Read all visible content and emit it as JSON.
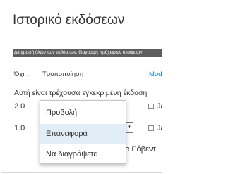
{
  "panel": {
    "title": "Ιστορικό εκδόσεων",
    "command_bar_text": "Διαγραφή όλων των εκδόσεων, διαγραφή πρόχειρων στοιχείων"
  },
  "columns": {
    "no": "Όχι ↓",
    "modified": "Τροποποίηση",
    "modified_by": "Mod"
  },
  "current_note": "Αυτή είναι τρέχουσα εγκεκριμένη έκδοση",
  "versions": [
    {
      "number": "2.0",
      "side_text": "Ja"
    },
    {
      "number": "1.0",
      "side_text": "Ja"
    }
  ],
  "editor_text": "ρ Ρόβεντ",
  "dropdown_glyph": "▾",
  "context_menu": {
    "items": [
      "Προβολή",
      "Επαναφορά",
      "Να διαγράψετε"
    ]
  }
}
